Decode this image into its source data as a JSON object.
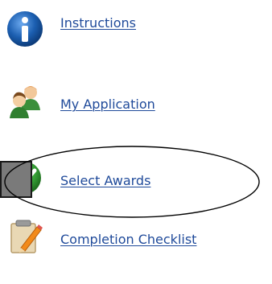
{
  "menu": {
    "items": [
      {
        "label": "Instructions",
        "icon": "info-icon"
      },
      {
        "label": "My Application",
        "icon": "users-icon"
      },
      {
        "label": "Select Awards",
        "icon": "checkmark-icon"
      },
      {
        "label": "Completion Checklist",
        "icon": "clipboard-pencil-icon"
      }
    ]
  },
  "colors": {
    "link": "#1f4a9a",
    "info_icon": "#1b5eb0",
    "check_icon": "#3aa63a",
    "annotation": "#000000"
  }
}
